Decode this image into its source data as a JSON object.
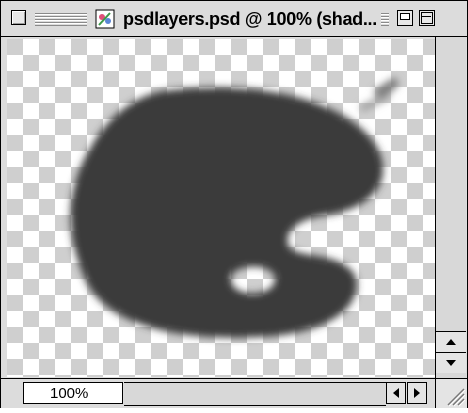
{
  "window": {
    "title": "psdlayers.psd @ 100% (shad...",
    "zoom": "100%"
  },
  "icons": {
    "close": "close-box-icon",
    "document": "photoshop-document-icon",
    "collapse": "windowshade-collapse-icon",
    "zoom": "zoom-box-icon",
    "scroll_up": "arrow-up-icon",
    "scroll_down": "arrow-down-icon",
    "scroll_left": "arrow-left-icon",
    "scroll_right": "arrow-right-icon",
    "resize": "resize-grip-icon"
  },
  "colors": {
    "checker_light": "#ffffff",
    "checker_dark": "#cfcfcf",
    "shadow_fill": "#3a3a3a",
    "chrome": "#dcdcdc"
  }
}
